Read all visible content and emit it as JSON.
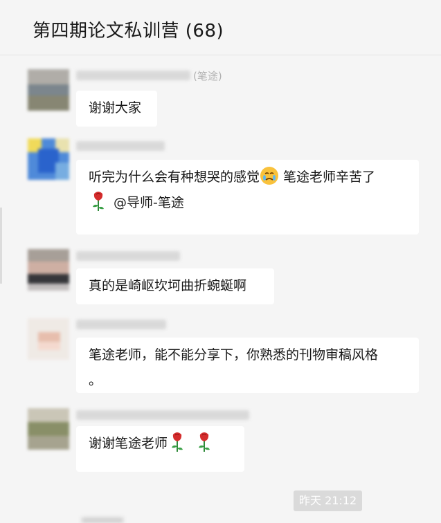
{
  "header": {
    "title": "第四期论文私训营 (68)"
  },
  "messages": [
    {
      "sender_suffix": "(笔途)",
      "text": "谢谢大家"
    },
    {
      "text_part1": "听完为什么会有种想哭的感觉",
      "text_part2": " 笔途老师辛苦了",
      "text_part3": "@导师-笔途",
      "emoji": "crying-face-icon",
      "icons": [
        "rose-icon"
      ]
    },
    {
      "text": "真的是崎岖坎坷曲折蜿蜒啊"
    },
    {
      "text_line1": "笔途老师，能不能分享下，你熟悉的刊物审稿风格",
      "text_line2": "。"
    },
    {
      "text": "谢谢笔途老师",
      "icons": [
        "rose-icon",
        "rose-icon"
      ]
    }
  ],
  "timestamp": "昨天 21:12",
  "colors": {
    "background": "#f5f5f5",
    "bubble": "#ffffff",
    "meta": "#b2b2b2"
  }
}
